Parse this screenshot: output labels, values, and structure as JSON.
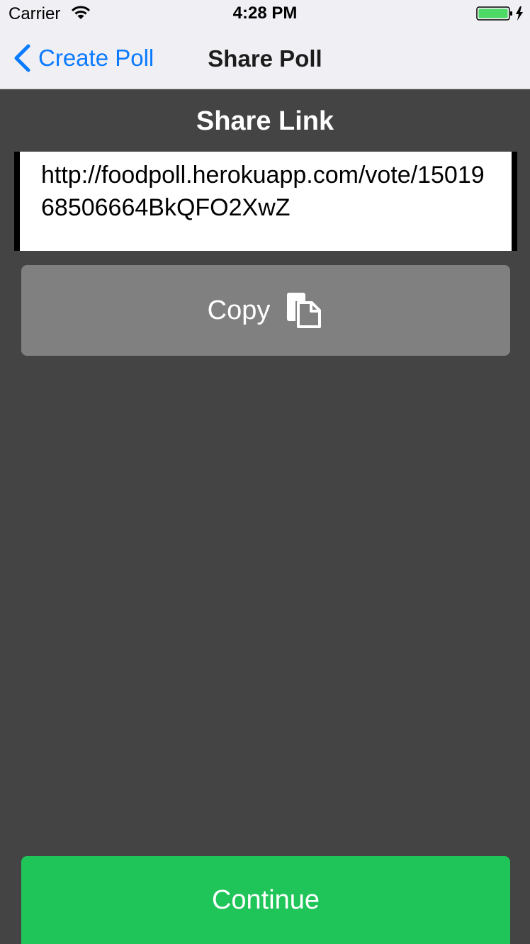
{
  "status_bar": {
    "carrier": "Carrier",
    "time": "4:28 PM",
    "wifi_icon": "wifi-icon",
    "battery_icon": "battery-charging-icon",
    "battery_color": "#4cd964"
  },
  "nav": {
    "back_label": "Create Poll",
    "back_icon": "chevron-left-icon",
    "title": "Share Poll",
    "accent": "#0a7aff"
  },
  "share": {
    "title": "Share Link",
    "link": "http://foodpoll.herokuapp.com/vote/1501968506664BkQFO2XwZ",
    "copy_label": "Copy",
    "copy_icon": "copy-icon"
  },
  "footer": {
    "continue_label": "Continue",
    "continue_color": "#1fc559"
  }
}
